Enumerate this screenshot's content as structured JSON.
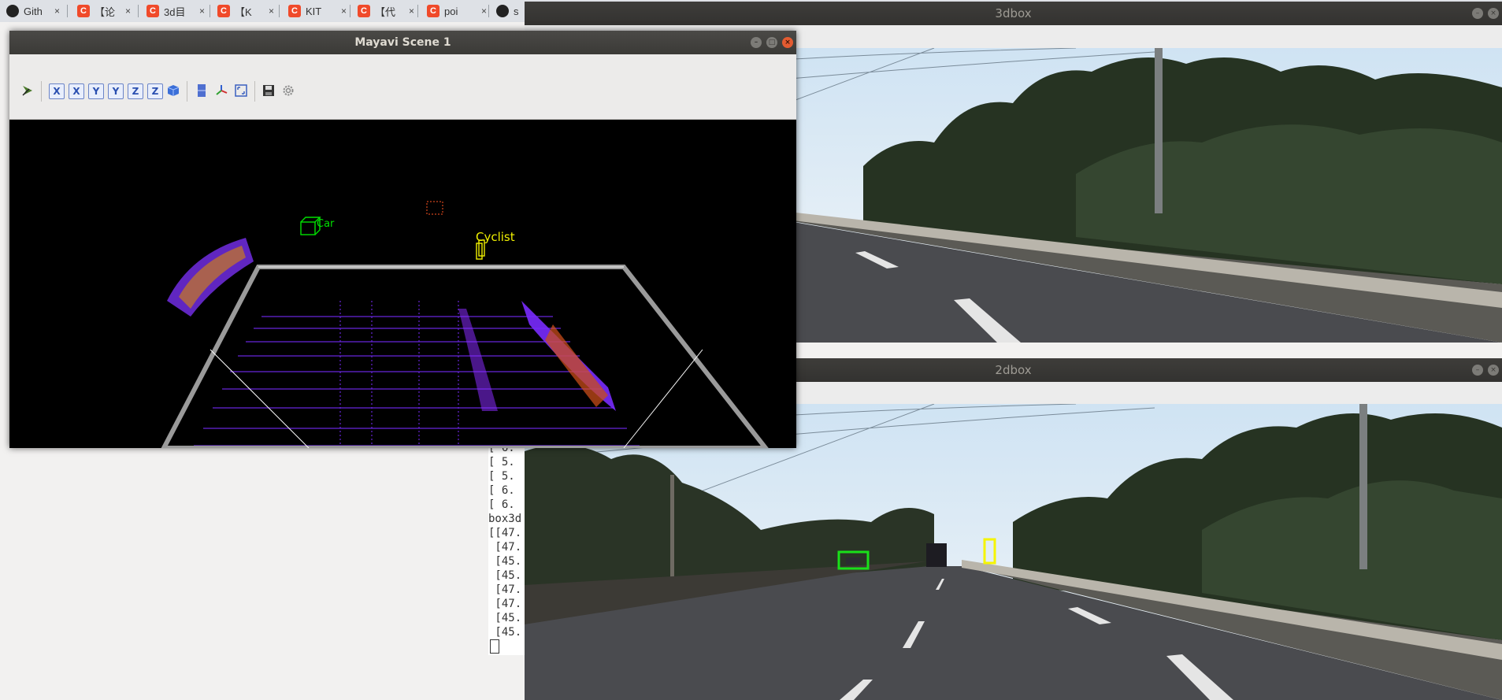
{
  "browser": {
    "tabs": [
      {
        "title": "Gith",
        "favicon": "github-icon"
      },
      {
        "title": "【论",
        "favicon": "csdn-icon"
      },
      {
        "title": "3d目",
        "favicon": "csdn-icon"
      },
      {
        "title": "【K",
        "favicon": "csdn-icon"
      },
      {
        "title": "KIT",
        "favicon": "csdn-icon"
      },
      {
        "title": "【代",
        "favicon": "csdn-icon"
      },
      {
        "title": "poi",
        "favicon": "csdn-icon"
      },
      {
        "title": "s",
        "favicon": "github-icon"
      }
    ],
    "csdn_letter": "C",
    "close_glyph": "×"
  },
  "mayavi": {
    "title": "Mayavi Scene 1",
    "toolbar": {
      "x_pos": "X",
      "x_neg": "X",
      "y_pos": "Y",
      "y_neg": "Y",
      "z_pos": "Z",
      "z_neg": "Z"
    },
    "labels": {
      "car": "Car",
      "cyclist": "Cyclist"
    },
    "colors": {
      "car": "#00e000",
      "cyclist": "#f0f000",
      "ground": "#7a2cff"
    }
  },
  "windows": {
    "box3d": {
      "title": "3dbox"
    },
    "box2d": {
      "title": "2dbox"
    }
  },
  "terminal": {
    "lines": [
      "[ 6.",
      "[ 5.",
      "[ 5.",
      "[ 6.",
      "[ 6.",
      "box3d",
      "[[47.",
      " [47.",
      " [45.",
      " [45.",
      " [47.",
      " [47.",
      " [45.",
      " [45."
    ]
  },
  "colors": {
    "car_box": "#19e019",
    "cyclist_box": "#f5f500",
    "sky": "#dfeaf4",
    "road": "#4a4b4f"
  }
}
